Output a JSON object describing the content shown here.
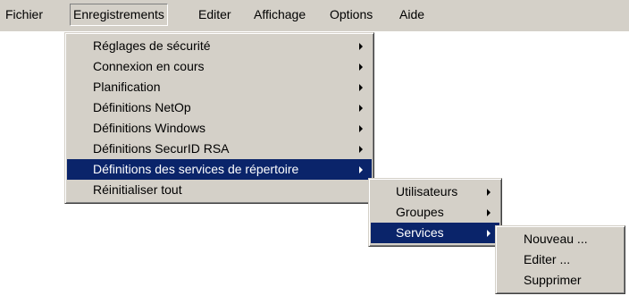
{
  "menubar": {
    "items": [
      {
        "label": "Fichier"
      },
      {
        "label": "Enregistrements"
      },
      {
        "label": "Editer"
      },
      {
        "label": "Affichage"
      },
      {
        "label": "Options"
      },
      {
        "label": "Aide"
      }
    ]
  },
  "enregistrements_menu": {
    "items": [
      {
        "label": "Réglages de sécurité",
        "has_submenu": true
      },
      {
        "label": "Connexion en cours",
        "has_submenu": true
      },
      {
        "label": "Planification",
        "has_submenu": true
      },
      {
        "label": "Définitions NetOp",
        "has_submenu": true
      },
      {
        "label": "Définitions Windows",
        "has_submenu": true
      },
      {
        "label": "Définitions SecurID RSA",
        "has_submenu": true
      },
      {
        "label": "Définitions des services de répertoire",
        "has_submenu": true,
        "highlighted": true
      },
      {
        "label": "Réinitialiser tout",
        "has_submenu": false
      }
    ]
  },
  "repertoire_submenu": {
    "items": [
      {
        "label": "Utilisateurs",
        "has_submenu": true
      },
      {
        "label": "Groupes",
        "has_submenu": true
      },
      {
        "label": "Services",
        "has_submenu": true,
        "highlighted": true
      }
    ]
  },
  "services_submenu": {
    "items": [
      {
        "label": "Nouveau ..."
      },
      {
        "label": "Editer ..."
      },
      {
        "label": "Supprimer"
      }
    ]
  },
  "colors": {
    "menu_face": "#d4d0c8",
    "highlight": "#0a246a",
    "highlight_text": "#ffffff"
  }
}
